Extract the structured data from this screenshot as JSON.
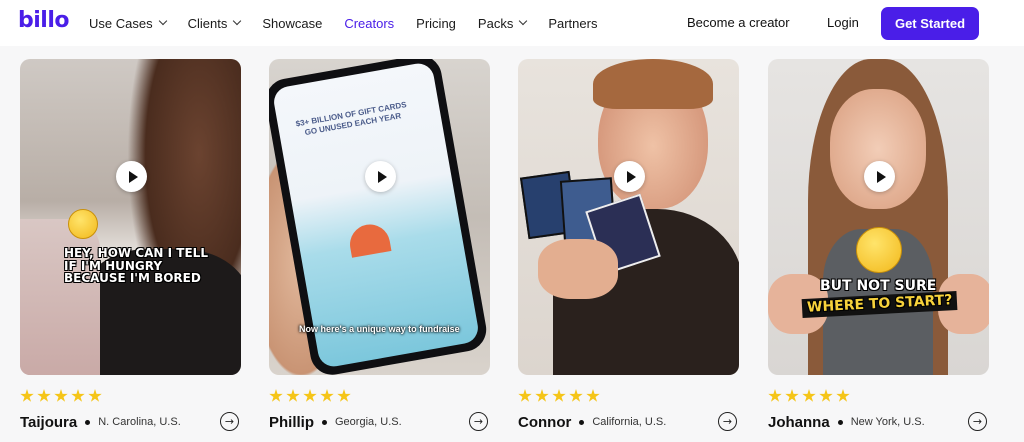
{
  "nav": {
    "logo": "billo",
    "links": [
      {
        "label": "Use Cases",
        "dropdown": true
      },
      {
        "label": "Clients",
        "dropdown": true
      },
      {
        "label": "Showcase",
        "dropdown": false
      },
      {
        "label": "Creators",
        "dropdown": false,
        "active": true
      },
      {
        "label": "Pricing",
        "dropdown": false
      },
      {
        "label": "Packs",
        "dropdown": true
      },
      {
        "label": "Partners",
        "dropdown": false
      }
    ],
    "become_creator": "Become a creator",
    "login": "Login",
    "cta": "Get Started"
  },
  "colors": {
    "brand": "#4a1ee8",
    "star": "#f5c518"
  },
  "creators": [
    {
      "name": "Taijoura",
      "location": "N. Carolina, U.S.",
      "rating": 5,
      "caption": "Hey, how can I tell if I'm hungry because I'm bored"
    },
    {
      "name": "Phillip",
      "location": "Georgia, U.S.",
      "rating": 5,
      "caption": "Now here's a unique way to fundraise",
      "screen_text": "$3+ BILLION OF GIFT CARDS GO UNUSED EACH YEAR"
    },
    {
      "name": "Connor",
      "location": "California, U.S.",
      "rating": 5,
      "caption": ""
    },
    {
      "name": "Johanna",
      "location": "New York, U.S.",
      "rating": 5,
      "caption_top": "But not sure",
      "caption_bottom": "where to start?"
    }
  ]
}
